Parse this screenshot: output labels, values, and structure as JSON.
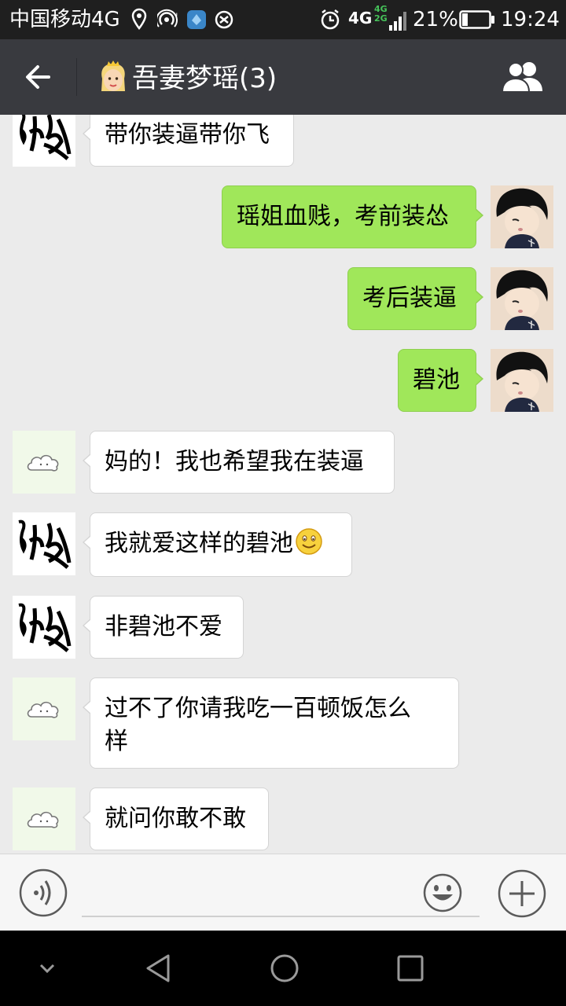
{
  "status_bar": {
    "carrier": "中国移动4G",
    "network_main": "4G",
    "network_sub_top": "4G",
    "network_sub_bottom": "2G",
    "battery_percent": "21%",
    "battery_level": 0.21,
    "time": "19:24",
    "icons": [
      "location-icon",
      "hotspot-icon",
      "app-notification-icon",
      "sync-icon",
      "alarm-icon",
      "signal-icon",
      "battery-icon"
    ]
  },
  "title_bar": {
    "title": "吾妻梦瑶(3)",
    "back_icon": "arrow-left-icon",
    "emoji_icon": "princess-emoji-icon",
    "group_icon": "group-members-icon"
  },
  "messages": [
    {
      "side": "in",
      "avatar": "calligraphy-avatar",
      "text": "带你装逼带你飞"
    },
    {
      "side": "out",
      "avatar": "cartoon-boy-avatar",
      "text": "瑶姐血贱，考前装怂"
    },
    {
      "side": "out",
      "avatar": "cartoon-boy-avatar",
      "text": "考后装逼"
    },
    {
      "side": "out",
      "avatar": "cartoon-boy-avatar",
      "text": "碧池"
    },
    {
      "side": "in",
      "avatar": "cloud-avatar",
      "text": "妈的！我也希望我在装逼"
    },
    {
      "side": "in",
      "avatar": "calligraphy-avatar",
      "text": "我就爱这样的碧池",
      "emoji": "smiley-emoji-icon"
    },
    {
      "side": "in",
      "avatar": "calligraphy-avatar",
      "text": "非碧池不爱"
    },
    {
      "side": "in",
      "avatar": "cloud-avatar",
      "text_line1": "过不了你请我吃一百顿饭怎么",
      "text_line2": "样"
    },
    {
      "side": "in",
      "avatar": "cloud-avatar",
      "text": "就问你敢不敢"
    }
  ],
  "input_bar": {
    "voice_icon": "voice-input-icon",
    "input_value": "",
    "emoji_icon": "emoji-face-icon",
    "plus_icon": "plus-icon"
  },
  "nav_bar": {
    "icons": [
      "collapse-chevron-icon",
      "back-triangle-icon",
      "home-circle-icon",
      "recents-square-icon"
    ]
  },
  "colors": {
    "status_bg": "#1f1f1f",
    "title_bg": "#393a3f",
    "chat_bg": "#ebebeb",
    "bubble_out": "#a0e75a",
    "bubble_in": "#ffffff",
    "input_bg": "#f6f6f6",
    "nav_bg": "#000000"
  }
}
